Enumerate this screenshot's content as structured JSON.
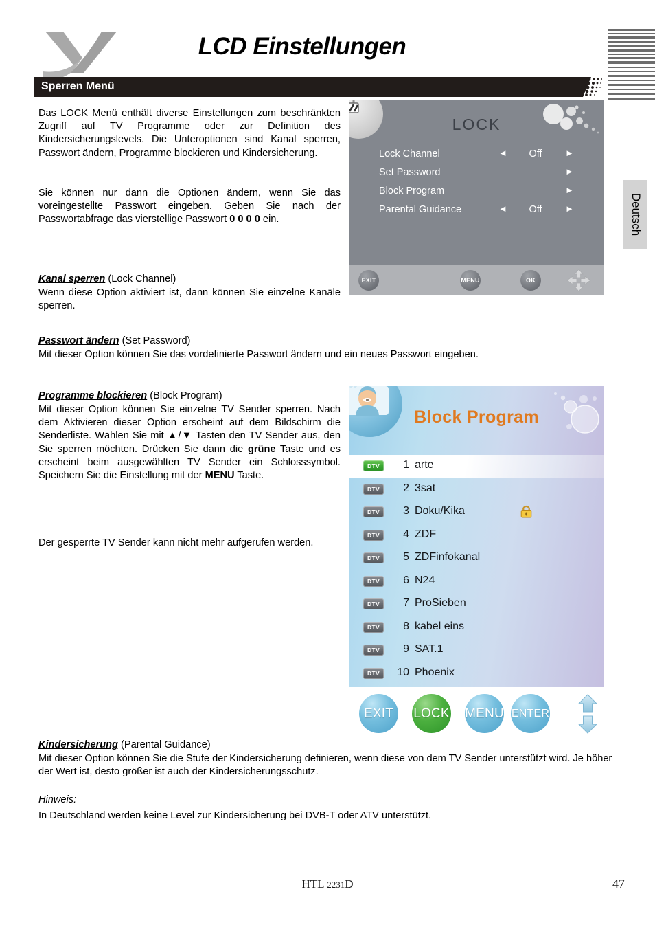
{
  "header": {
    "logo": "xoro-x-logo",
    "title": "LCD Einstellungen",
    "section_title": "Sperren Menü"
  },
  "language_tab": {
    "label": "Deutsch"
  },
  "body": {
    "intro_p1": "Das LOCK Menü enthält diverse Einstellungen zum beschränkten Zugriff auf TV Programme oder zur Definition des Kindersicherungslevels. Die Unteroptionen sind Kanal sperren, Passwort ändern, Programme blockieren und Kindersicherung.",
    "intro_p2_a": "Sie können nur dann die Optionen ändern, wenn Sie das voreingestellte Passwort eingeben. Geben Sie nach der Passwortabfrage das vierstellige Passwort ",
    "intro_p2_bold": "0 0 0 0",
    "intro_p2_b": " ein.",
    "s1_heading": "Kanal sperren",
    "s1_heading_en": " (Lock Channel)",
    "s1_text": "Wenn diese Option aktiviert ist, dann können Sie einzelne Kanäle sperren.",
    "s2_heading": "Passwort ändern",
    "s2_heading_en": " (Set Password)",
    "s2_text": "Mit dieser Option können Sie das vordefinierte Passwort ändern und ein neues Passwort eingeben.",
    "s3_heading": "Programme blockieren",
    "s3_heading_en": " (Block Program)",
    "s3_text_a": "Mit dieser Option können Sie einzelne TV Sender sperren. Nach dem Aktivieren dieser Option erscheint auf dem Bildschirm die Senderliste. Wählen Sie mit ▲/▼ Tasten den TV Sender aus, den Sie sperren möchten. Drücken Sie dann die ",
    "s3_text_bold1": "grüne",
    "s3_text_b": " Taste und es erscheint beim ausgewählten TV Sender ein Schlosssymbol. Speichern Sie die Einstellung mit der ",
    "s3_text_bold2": "MENU",
    "s3_text_c": " Taste.",
    "s3_text2": "Der gesperrte TV Sender kann nicht mehr aufgerufen werden.",
    "s4_heading": "Kindersicherung",
    "s4_heading_en": " (Parental Guidance)",
    "s4_text": "Mit dieser Option können Sie die Stufe der Kindersicherung definieren, wenn diese von dem TV Sender unterstützt wird. Je höher der Wert ist, desto größer ist auch der Kindersicherungsschutz.",
    "note_label": "Hinweis:",
    "note_text": "In Deutschland werden keine Level zur Kindersicherung bei DVB-T oder ATV unterstützt."
  },
  "tv_lock_screen": {
    "title": "LOCK",
    "icon": "padlock-icon",
    "rows": [
      {
        "label": "Lock Channel",
        "value": "Off",
        "left_arrow": "◄",
        "right_arrow": "►",
        "has_left_arrow": true,
        "has_value": true
      },
      {
        "label": "Set Password",
        "value": "",
        "left_arrow": "",
        "right_arrow": "►",
        "has_left_arrow": false,
        "has_value": false
      },
      {
        "label": "Block Program",
        "value": "",
        "left_arrow": "",
        "right_arrow": "►",
        "has_left_arrow": false,
        "has_value": false
      },
      {
        "label": "Parental Guidance",
        "value": "Off",
        "left_arrow": "◄",
        "right_arrow": "►",
        "has_left_arrow": true,
        "has_value": true
      }
    ],
    "footer_buttons": [
      {
        "label": "EXIT"
      },
      {
        "label": "MENU"
      },
      {
        "label": "OK"
      }
    ],
    "dpad": "dpad-icon"
  },
  "tv_block_screen": {
    "title": "Block Program",
    "title_color": "#e07a20",
    "avatar": "person-avatar-icon",
    "channels": [
      {
        "badge": "DTV",
        "num": "1",
        "name": "arte",
        "selected": true,
        "locked": false
      },
      {
        "badge": "DTV",
        "num": "2",
        "name": "3sat",
        "selected": false,
        "locked": false
      },
      {
        "badge": "DTV",
        "num": "3",
        "name": "Doku/Kika",
        "selected": false,
        "locked": true
      },
      {
        "badge": "DTV",
        "num": "4",
        "name": "ZDF",
        "selected": false,
        "locked": false
      },
      {
        "badge": "DTV",
        "num": "5",
        "name": "ZDFinfokanal",
        "selected": false,
        "locked": false
      },
      {
        "badge": "DTV",
        "num": "6",
        "name": "N24",
        "selected": false,
        "locked": false
      },
      {
        "badge": "DTV",
        "num": "7",
        "name": "ProSieben",
        "selected": false,
        "locked": false
      },
      {
        "badge": "DTV",
        "num": "8",
        "name": "kabel eins",
        "selected": false,
        "locked": false
      },
      {
        "badge": "DTV",
        "num": "9",
        "name": "SAT.1",
        "selected": false,
        "locked": false
      },
      {
        "badge": "DTV",
        "num": "10",
        "name": "Phoenix",
        "selected": false,
        "locked": false
      }
    ],
    "footer_buttons": [
      {
        "label": "EXIT",
        "color": "blue"
      },
      {
        "label": "LOCK",
        "color": "green"
      },
      {
        "label": "MENU",
        "color": "blue"
      },
      {
        "label": "ENTER",
        "color": "blue"
      }
    ],
    "updown": "up-down-arrows-icon"
  },
  "footer": {
    "model_prefix": "HTL ",
    "model_number": "2231",
    "model_suffix": "D",
    "page_number": "47"
  }
}
